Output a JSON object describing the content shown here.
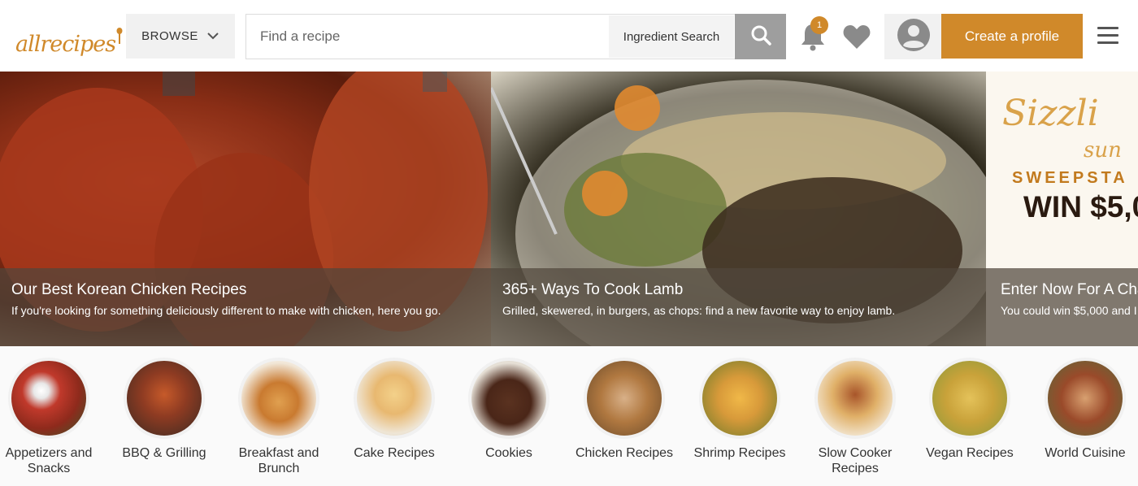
{
  "header": {
    "logo_text": "allrecipes",
    "browse_label": "BROWSE",
    "search_placeholder": "Find a recipe",
    "ingredient_search_label": "Ingredient Search",
    "notification_count": "1",
    "create_profile_label": "Create a profile",
    "icons": {
      "search": "search-icon",
      "browse": "chevron-down-icon",
      "notifications": "bell-icon",
      "favorites": "heart-icon",
      "profile": "user-icon",
      "menu": "hamburger-menu-icon"
    }
  },
  "carousel": {
    "slides": [
      {
        "title": "Our Best Korean Chicken Recipes",
        "subtitle": "If you're looking for something deliciously different to make with chicken, here you go."
      },
      {
        "title": "365+ Ways To Cook Lamb",
        "subtitle": "Grilled, skewered, in burgers, as chops: find a new favorite way to enjoy lamb."
      },
      {
        "title": "Enter Now For A Cha",
        "subtitle": "You could win $5,000 and I",
        "promo_line1": "Sizzli",
        "promo_line2": "sun",
        "promo_line3": "SWEEPSTA",
        "promo_line4": "WIN $5,0"
      }
    ]
  },
  "categories": [
    {
      "label": "Appetizers and Snacks",
      "color": "#c0392b"
    },
    {
      "label": "BBQ & Grilling",
      "color": "#8e3b22"
    },
    {
      "label": "Breakfast and Brunch",
      "color": "#e0a050"
    },
    {
      "label": "Cake Recipes",
      "color": "#e8b870"
    },
    {
      "label": "Cookies",
      "color": "#5a3220"
    },
    {
      "label": "Chicken Recipes",
      "color": "#b07840"
    },
    {
      "label": "Shrimp Recipes",
      "color": "#d89a3a"
    },
    {
      "label": "Slow Cooker Recipes",
      "color": "#a8552a"
    },
    {
      "label": "Vegan Recipes",
      "color": "#c9a23a"
    },
    {
      "label": "World Cuisine",
      "color": "#9a4a2a"
    }
  ],
  "colors": {
    "accent": "#d0892a",
    "search_button": "#9e9e9e"
  }
}
